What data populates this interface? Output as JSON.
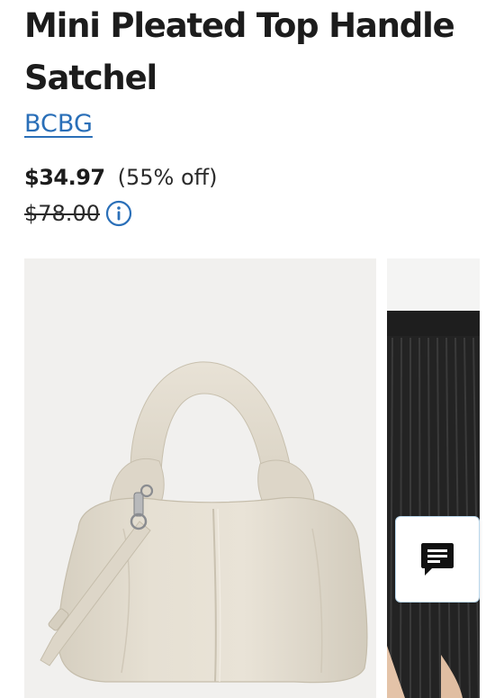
{
  "product": {
    "title": "Mini Pleated Top Handle Satchel",
    "brand": "BCBG",
    "sale_price": "$34.97",
    "discount": "(55% off)",
    "original_price": "$78.00"
  },
  "icons": {
    "info": "info-circle-icon",
    "chat": "chat-bubble-icon"
  },
  "colors": {
    "brand_link": "#2a6fb8",
    "info_icon": "#2a6fb8",
    "text": "#1c1c1c",
    "bag": "#e3ddd0",
    "image_bg": "#f1f0ee"
  }
}
